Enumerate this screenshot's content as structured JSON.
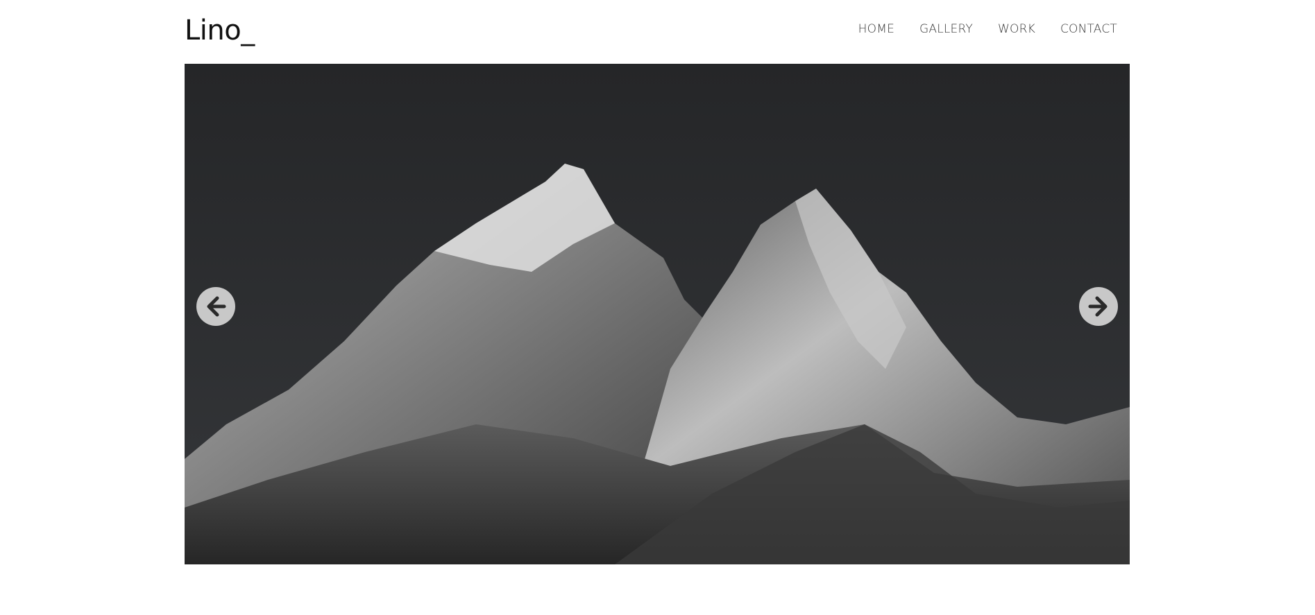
{
  "header": {
    "logo": "Lino_",
    "nav": [
      {
        "label": "HOME"
      },
      {
        "label": "GALLERY"
      },
      {
        "label": "WORK"
      },
      {
        "label": "CONTACT"
      }
    ]
  },
  "slider": {
    "image_subject": "snow-capped mountain peaks",
    "prev_icon": "arrow-left-circle-icon",
    "next_icon": "arrow-right-circle-icon",
    "colors": {
      "sky": "#2a2b2d",
      "arrow_bg": "#c8c8c8",
      "arrow_fg": "#2a2a2a"
    }
  }
}
